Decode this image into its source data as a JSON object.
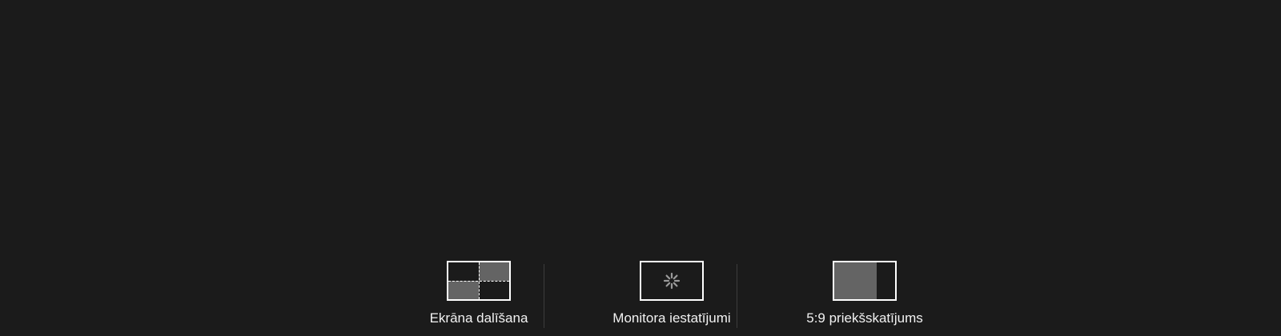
{
  "toolbar": {
    "options": [
      {
        "label": "Ekrāna dalīšana",
        "icon": "split-screen-icon"
      },
      {
        "label": "Monitora iestatījumi",
        "icon": "monitor-settings-icon"
      },
      {
        "label": "5:9 priekšskatījums",
        "icon": "preview-5-9-icon"
      }
    ]
  },
  "colors": {
    "background": "#1b1b1b",
    "thumb_border": "#ffffff",
    "thumb_fill": "#646464",
    "divider": "#3c3c3c",
    "label_text": "#f2f2f2"
  }
}
